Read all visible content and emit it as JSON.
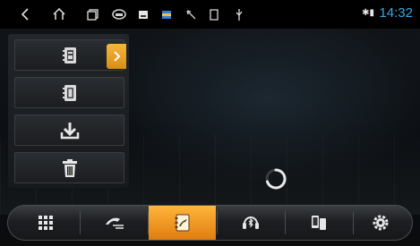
{
  "status_bar": {
    "icons": [
      "back-icon",
      "home-icon",
      "recent-apps-icon",
      "steering-wheel-icon",
      "image-icon",
      "media-icon",
      "navigation-icon",
      "sd-card-icon",
      "usb-icon"
    ],
    "bluetooth": "✱▮",
    "time": "14:32"
  },
  "left_menu": {
    "items": [
      {
        "name": "contacts-book",
        "selected": true
      },
      {
        "name": "phonebook-sync",
        "selected": false
      },
      {
        "name": "download",
        "selected": false
      },
      {
        "name": "delete",
        "selected": false
      }
    ]
  },
  "dock": {
    "items": [
      {
        "name": "dialpad",
        "active": false
      },
      {
        "name": "call-log",
        "active": false
      },
      {
        "name": "contacts",
        "active": true
      },
      {
        "name": "bt-music",
        "active": false
      },
      {
        "name": "phone-link",
        "active": false
      },
      {
        "name": "settings",
        "active": false
      }
    ]
  },
  "colors": {
    "accent": "#f0a52a",
    "clock": "#39a7e6"
  }
}
